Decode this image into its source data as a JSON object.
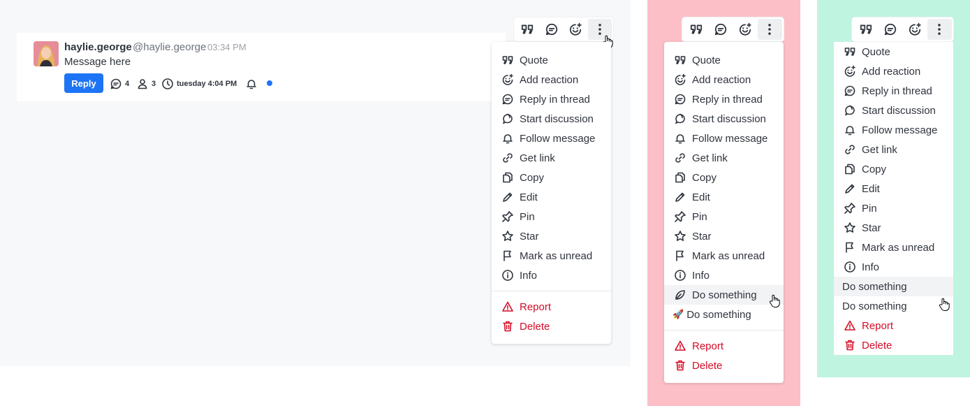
{
  "message": {
    "username": "haylie.george",
    "handle": "@haylie.george",
    "time": "03:34 PM",
    "body": "Message here",
    "reply_label": "Reply",
    "thread_count": "4",
    "participants_count": "3",
    "last_reply": "tuesday 4:04 PM"
  },
  "colors": {
    "primary": "#1d74f5",
    "danger": "#d40c26",
    "panel_bg": "#f7f8fa",
    "pink_bg": "#fdbfc7",
    "mint_bg": "#bff4e1"
  },
  "toolbar_icons": [
    "quote-icon",
    "reply-in-thread-icon",
    "add-reaction-icon",
    "kebab-menu-icon"
  ],
  "menu1": {
    "items": [
      "Quote",
      "Add reaction",
      "Reply in thread",
      "Start discussion",
      "Follow message",
      "Get link",
      "Copy",
      "Edit",
      "Pin",
      "Star",
      "Mark as unread",
      "Info"
    ],
    "danger": [
      "Report",
      "Delete"
    ]
  },
  "menu2": {
    "items": [
      "Quote",
      "Add reaction",
      "Reply in thread",
      "Start discussion",
      "Follow message",
      "Get link",
      "Copy",
      "Edit",
      "Pin",
      "Star",
      "Mark as unread",
      "Info",
      "Do something"
    ],
    "extra_item": "Do something",
    "extra_emoji": "🚀",
    "danger": [
      "Report",
      "Delete"
    ]
  },
  "menu3": {
    "items": [
      "Quote",
      "Add reaction",
      "Reply in thread",
      "Start discussion",
      "Follow message",
      "Get link",
      "Copy",
      "Edit",
      "Pin",
      "Star",
      "Mark as unread",
      "Info"
    ],
    "plain_items": [
      "Do something",
      "Do something"
    ],
    "danger": [
      "Report",
      "Delete"
    ]
  }
}
